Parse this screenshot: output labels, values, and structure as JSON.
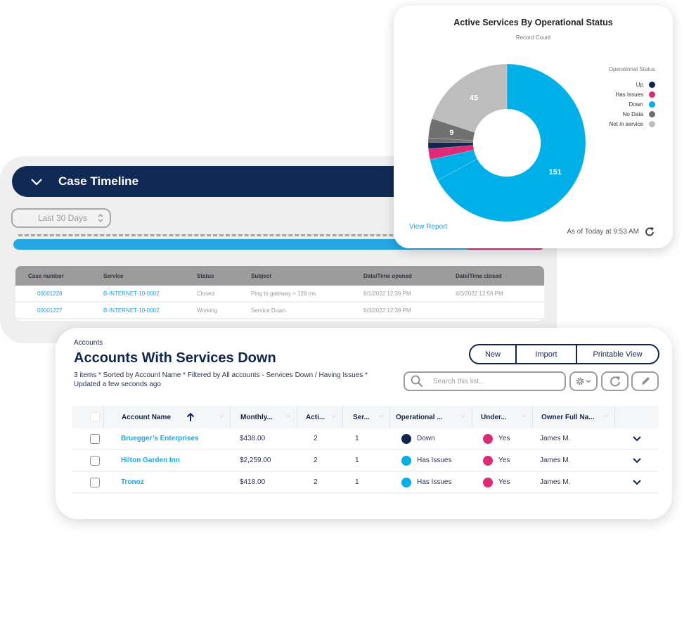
{
  "timeline": {
    "title": "Case Timeline",
    "range_select": "Last 30 Days",
    "progress_colors": {
      "primary": "#24a7e2",
      "secondary": "#de2b78"
    },
    "table": {
      "headers": [
        "Case number",
        "Service",
        "Status",
        "Subject",
        "Date/Time opened",
        "Date/Time closed"
      ],
      "rows": [
        [
          "00001228",
          "B-INTERNET-10-0002",
          "Closed",
          "Ping to gateway > 128 ms",
          "8/1/2022 12:39 PM",
          "8/3/2022 12:59 PM"
        ],
        [
          "00001227",
          "B-INTERNET-10-0002",
          "Working",
          "Service Down",
          "8/3/2022 12:39 PM",
          ""
        ]
      ]
    }
  },
  "chart_card": {
    "view_report": "View Report",
    "as_of": "As of Today at 9:53 AM"
  },
  "chart_data": {
    "type": "pie",
    "variant": "donut",
    "title": "Active Services By Operational Status",
    "subtitle": "Record Count",
    "legend_title": "Operational Status",
    "legend_position": "right",
    "legend": [
      {
        "label": "Up",
        "color": "#12264d"
      },
      {
        "label": "Has Issues",
        "color": "#de2b78"
      },
      {
        "label": "Down",
        "color": "#00aee8"
      },
      {
        "label": "No Data",
        "color": "#707070"
      },
      {
        "label": "Not in service",
        "color": "#bdbdbd"
      }
    ],
    "slices": [
      {
        "label": "Down",
        "value": 151,
        "color": "#00aee8",
        "show_label": true
      },
      {
        "label": "Down",
        "value": 10,
        "color": "#00aee8",
        "show_label": false
      },
      {
        "label": "Has Issues",
        "value": 5,
        "color": "#de2b78",
        "show_label": false
      },
      {
        "label": "Up",
        "value": 3,
        "color": "#12264d",
        "show_label": false
      },
      {
        "label": "No Data",
        "value": 2,
        "color": "#707070",
        "show_label": false
      },
      {
        "label": "No Data",
        "value": 9,
        "color": "#707070",
        "show_label": true
      },
      {
        "label": "Not in service",
        "value": 45,
        "color": "#bdbdbd",
        "show_label": true
      }
    ]
  },
  "accounts": {
    "breadcrumb": "Accounts",
    "title": "Accounts With Services Down",
    "meta": "3 items * Sorted by Account Name * Filtered by All accounts - Services Down / Having Issues * Updated a few seconds ago",
    "buttons": {
      "new": "New",
      "import": "Import",
      "printable": "Printable View"
    },
    "search_placeholder": "Search this list...",
    "columns": [
      "Account Name",
      "Monthly...",
      "Acti...",
      "Ser...",
      "Operational ...",
      "Under...",
      "Owner Full Na..."
    ],
    "rows": [
      {
        "name": "Bruegger’s Enterprises",
        "monthly": "$438.00",
        "active": "2",
        "services": "1",
        "status": "Down",
        "status_color": "#12264d",
        "under": "Yes",
        "under_color": "#de2b78",
        "owner": "James M."
      },
      {
        "name": "Hilton Garden Inn",
        "monthly": "$2,259.00",
        "active": "2",
        "services": "1",
        "status": "Has Issues",
        "status_color": "#00aee8",
        "under": "Yes",
        "under_color": "#de2b78",
        "owner": "James M."
      },
      {
        "name": "Tronoz",
        "monthly": "$418.00",
        "active": "2",
        "services": "1",
        "status": "Has Issues",
        "status_color": "#00aee8",
        "under": "Yes",
        "under_color": "#de2b78",
        "owner": "James M."
      }
    ]
  }
}
